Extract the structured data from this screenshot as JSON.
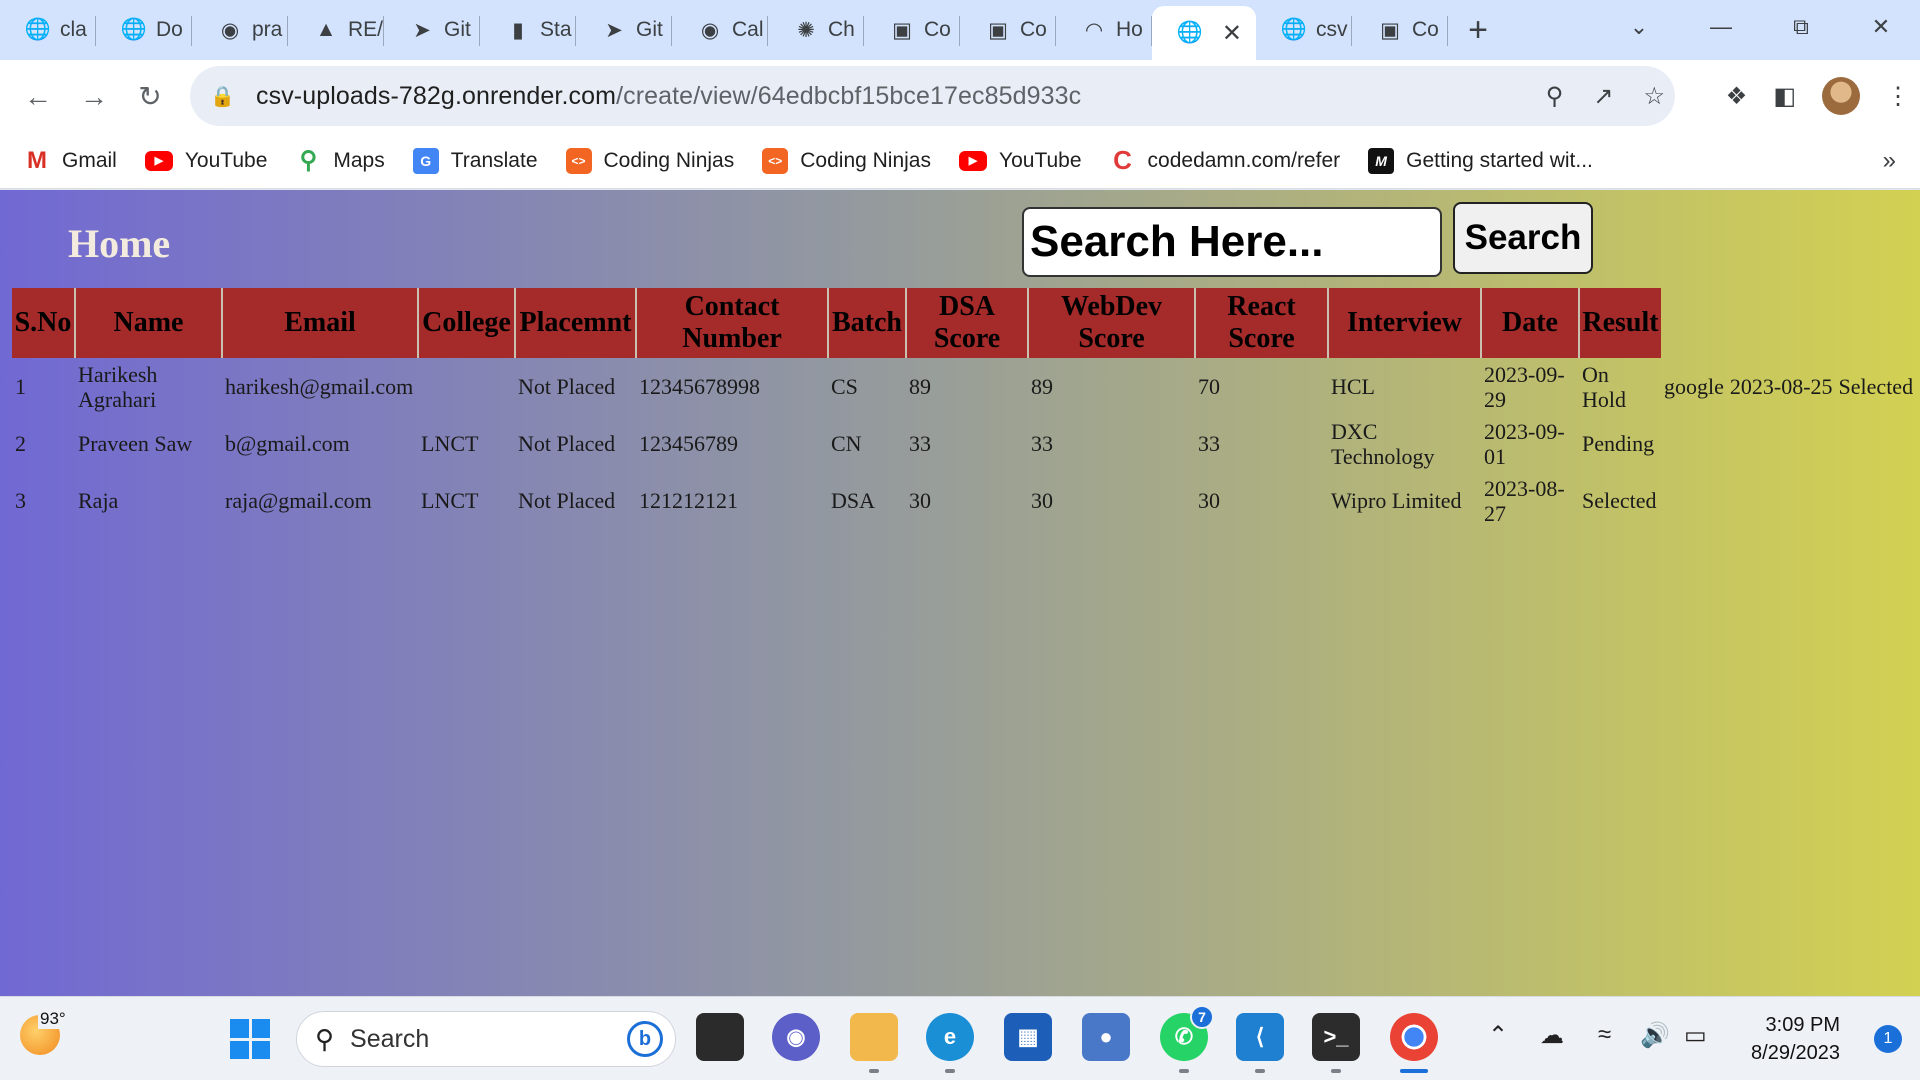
{
  "browser": {
    "tabs": [
      {
        "label": "cla",
        "icon": "globe-icon"
      },
      {
        "label": "Do",
        "icon": "globe-icon"
      },
      {
        "label": "pra",
        "icon": "github-icon"
      },
      {
        "label": "RE/",
        "icon": "triangle-icon"
      },
      {
        "label": "Git",
        "icon": "share-icon"
      },
      {
        "label": "Sta",
        "icon": "book-icon"
      },
      {
        "label": "Git",
        "icon": "share-icon"
      },
      {
        "label": "Cal",
        "icon": "github-icon"
      },
      {
        "label": "Ch",
        "icon": "chatgpt-icon"
      },
      {
        "label": "Co",
        "icon": "coding-ninjas-icon"
      },
      {
        "label": "Co",
        "icon": "coding-ninjas-icon"
      },
      {
        "label": "Ho",
        "icon": "loading-icon"
      },
      {
        "label": "",
        "icon": "globe-icon",
        "active": true
      },
      {
        "label": "csv",
        "icon": "globe-icon"
      },
      {
        "label": "Co",
        "icon": "coding-ninjas-icon"
      }
    ],
    "url_host": "csv-uploads-782g.onrender.com",
    "url_path": "/create/view/64edbcbf15bce17ec85d933c",
    "bookmarks": [
      {
        "label": "Gmail",
        "icon": "gmail-icon"
      },
      {
        "label": "YouTube",
        "icon": "youtube-icon"
      },
      {
        "label": "Maps",
        "icon": "maps-icon"
      },
      {
        "label": "Translate",
        "icon": "translate-icon"
      },
      {
        "label": "Coding Ninjas",
        "icon": "coding-ninjas-icon"
      },
      {
        "label": "Coding Ninjas",
        "icon": "coding-ninjas-icon"
      },
      {
        "label": "YouTube",
        "icon": "youtube-icon"
      },
      {
        "label": "codedamn.com/refer",
        "icon": "codedamn-icon"
      },
      {
        "label": "Getting started wit...",
        "icon": "medium-icon"
      }
    ]
  },
  "page": {
    "title": "Home",
    "search_placeholder": "Search Here...",
    "search_button": "Search",
    "table": {
      "headers": [
        "S.No",
        "Name",
        "Email",
        "College",
        "Placemnt",
        "Contact Number",
        "Batch",
        "DSA Score",
        "WebDev Score",
        "React Score",
        "Interview",
        "Date",
        "Result"
      ],
      "rows": [
        [
          "1",
          "Harikesh Agrahari",
          "harikesh@gmail.com",
          "",
          "Not Placed",
          "12345678998",
          "CS",
          "89",
          "89",
          "70",
          "HCL",
          "2023-09-29",
          "On Hold",
          "google",
          "2023-08-25",
          "Selected"
        ],
        [
          "2",
          "Praveen Saw",
          "b@gmail.com",
          "LNCT",
          "Not Placed",
          "123456789",
          "CN",
          "33",
          "33",
          "33",
          "DXC Technology",
          "2023-09-01",
          "Pending"
        ],
        [
          "3",
          "Raja",
          "raja@gmail.com",
          "LNCT",
          "Not Placed",
          "121212121",
          "DSA",
          "30",
          "30",
          "30",
          "Wipro Limited",
          "2023-08-27",
          "Selected"
        ]
      ]
    }
  },
  "taskbar": {
    "temperature": "93°",
    "search_label": "Search",
    "whatsapp_badge": "7",
    "time": "3:09 PM",
    "date": "8/29/2023",
    "notification_count": "1"
  }
}
